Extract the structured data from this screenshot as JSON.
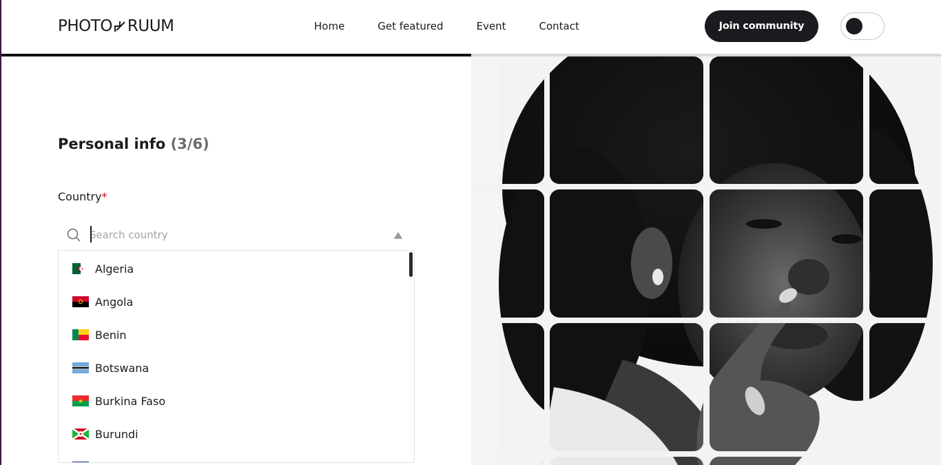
{
  "header": {
    "logo_left": "PHOTO",
    "logo_right": "RUUM",
    "nav": [
      "Home",
      "Get featured",
      "Event",
      "Contact"
    ],
    "join_label": "Join community",
    "theme_toggle": "dark-mode-toggle"
  },
  "progress": {
    "fraction": 0.5
  },
  "form": {
    "title": "Personal info",
    "step": "(3/6)",
    "country_label": "Country",
    "required_mark": "*",
    "search_placeholder": "Search country",
    "search_value": ""
  },
  "countries": [
    {
      "name": "Algeria",
      "flag": "algeria-flag"
    },
    {
      "name": "Angola",
      "flag": "angola-flag"
    },
    {
      "name": "Benin",
      "flag": "benin-flag"
    },
    {
      "name": "Botswana",
      "flag": "botswana-flag"
    },
    {
      "name": "Burkina Faso",
      "flag": "burkina-faso-flag"
    },
    {
      "name": "Burundi",
      "flag": "burundi-flag"
    }
  ],
  "colors": {
    "primary_dark": "#1b1b1f",
    "required": "#d0021b",
    "border": "#e3e3e6"
  },
  "icons": {
    "search": "search-icon",
    "dropdown": "arrow-up-icon"
  }
}
